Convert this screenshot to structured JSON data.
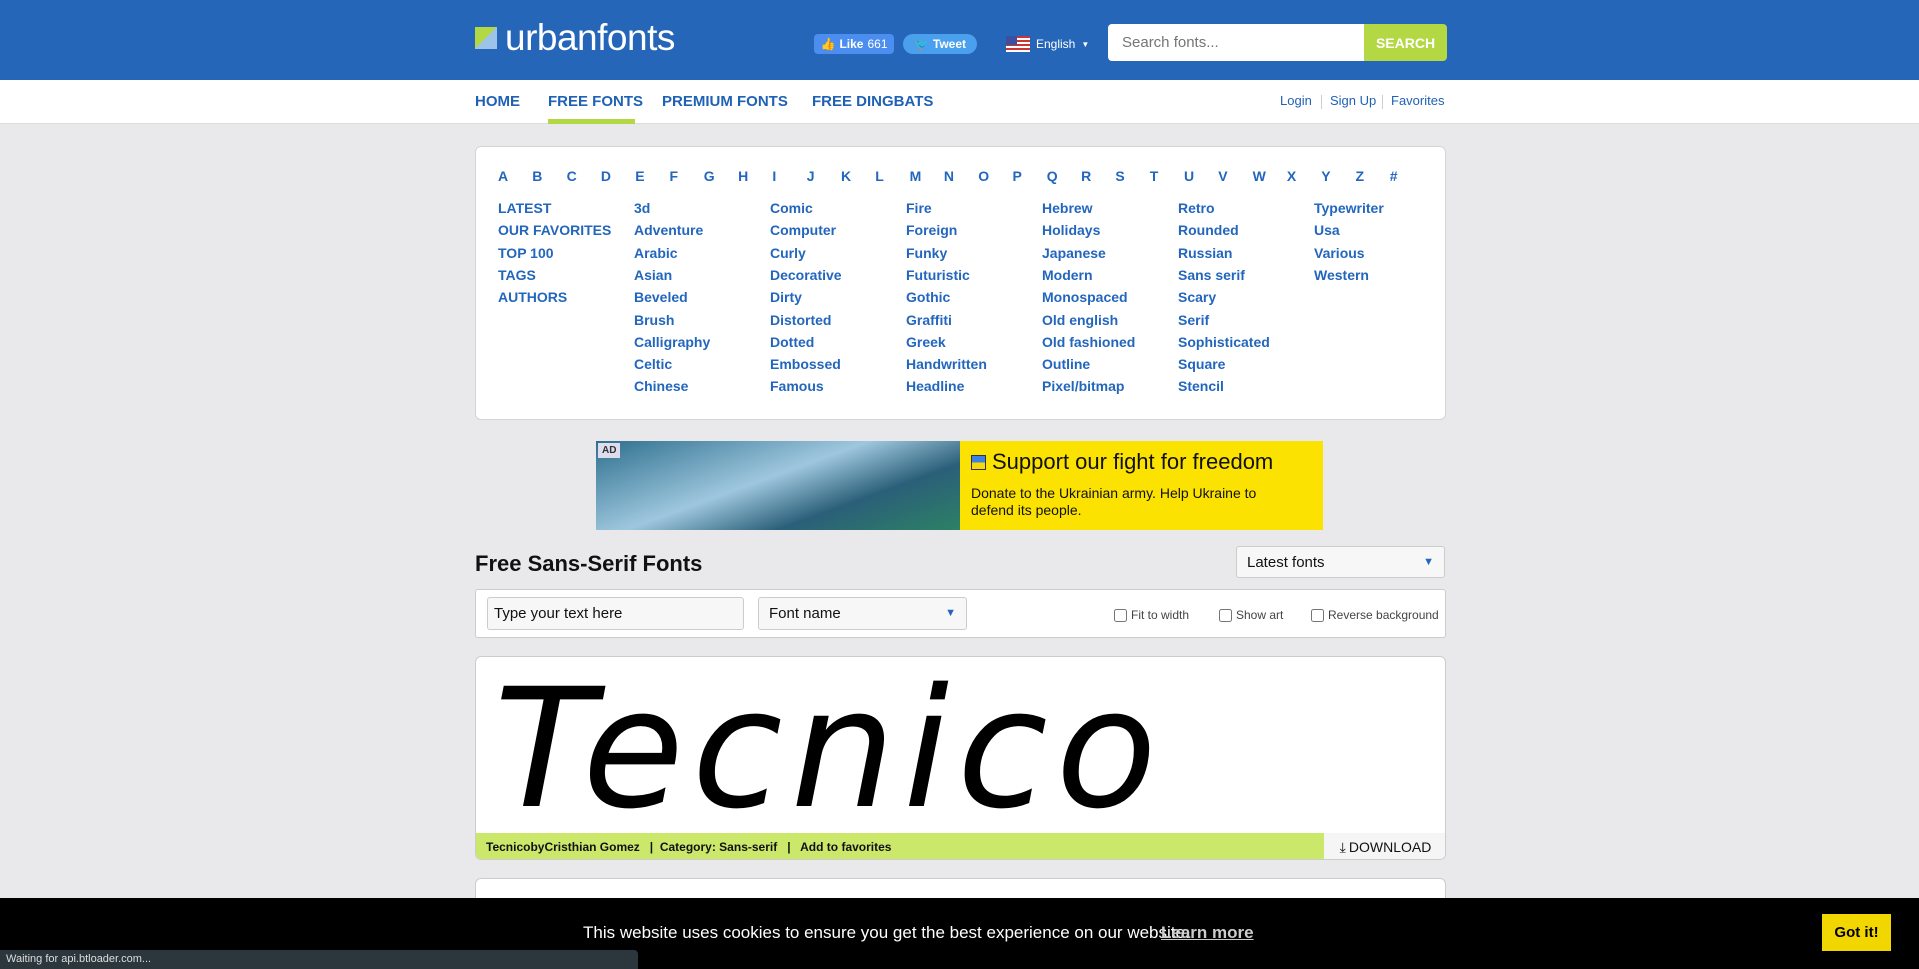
{
  "header": {
    "logo": "urbanfonts",
    "like_label": "Like",
    "like_count": "661",
    "tweet_label": "Tweet",
    "language": "English",
    "search_placeholder": "Search fonts...",
    "search_button": "SEARCH",
    "colors": {
      "brand": "#2566b8",
      "accent": "#b4d843"
    }
  },
  "nav": {
    "items": [
      "HOME",
      "FREE FONTS",
      "PREMIUM FONTS",
      "FREE DINGBATS"
    ],
    "active": "FREE FONTS",
    "account": [
      "Login",
      "Sign Up",
      "Favorites"
    ]
  },
  "letters": [
    "A",
    "B",
    "C",
    "D",
    "E",
    "F",
    "G",
    "H",
    "I",
    "J",
    "K",
    "L",
    "M",
    "N",
    "O",
    "P",
    "Q",
    "R",
    "S",
    "T",
    "U",
    "V",
    "W",
    "X",
    "Y",
    "Z",
    "#"
  ],
  "categories": [
    [
      "LATEST",
      "OUR FAVORITES",
      "TOP 100",
      "TAGS",
      "AUTHORS"
    ],
    [
      "3d",
      "Adventure",
      "Arabic",
      "Asian",
      "Beveled",
      "Brush",
      "Calligraphy",
      "Celtic",
      "Chinese"
    ],
    [
      "Comic",
      "Computer",
      "Curly",
      "Decorative",
      "Dirty",
      "Distorted",
      "Dotted",
      "Embossed",
      "Famous"
    ],
    [
      "Fire",
      "Foreign",
      "Funky",
      "Futuristic",
      "Gothic",
      "Graffiti",
      "Greek",
      "Handwritten",
      "Headline"
    ],
    [
      "Hebrew",
      "Holidays",
      "Japanese",
      "Modern",
      "Monospaced",
      "Old english",
      "Old fashioned",
      "Outline",
      "Pixel/bitmap"
    ],
    [
      "Retro",
      "Rounded",
      "Russian",
      "Sans serif",
      "Scary",
      "Serif",
      "Sophisticated",
      "Square",
      "Stencil"
    ],
    [
      "Typewriter",
      "Usa",
      "Various",
      "Western"
    ]
  ],
  "ad": {
    "tag": "AD",
    "title": "Support our fight for freedom",
    "body": "Donate to the Ukrainian army. Help Ukraine to defend its people."
  },
  "main": {
    "title": "Free Sans-Serif Fonts",
    "sort": "Latest fonts",
    "text_placeholder": "Type your text here",
    "font_select": "Font name",
    "options": [
      "Fit to width",
      "Show art",
      "Reverse background"
    ]
  },
  "font": {
    "preview": "Tecnico",
    "meta": "TecnicobyCristhian Gomez   |  Category: Sans-serif   |   Add to favorites",
    "download": "DOWNLOAD"
  },
  "cookie": {
    "text": "This website uses cookies to ensure you get the best experience on our website.",
    "learn_more": "Learn more",
    "button": "Got it!"
  },
  "status": "Waiting for api.btloader.com..."
}
